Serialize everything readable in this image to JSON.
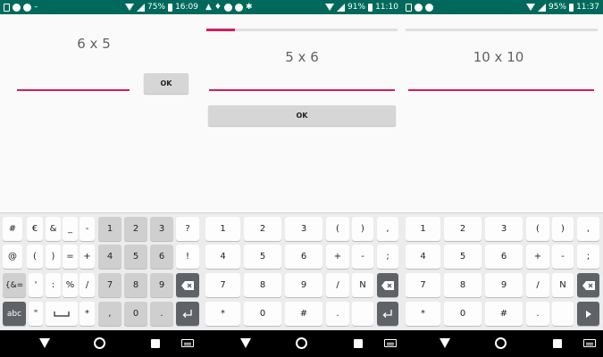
{
  "panels": [
    {
      "status": {
        "battery_pct": "75%",
        "time": "16:09"
      },
      "question": "6 x 5",
      "ok_label": "OK",
      "keys": [
        [
          "#",
          "€",
          "&",
          "_",
          "-",
          "1",
          "2",
          "3",
          "?"
        ],
        [
          "@",
          "(",
          ")",
          "=",
          "+",
          "4",
          "5",
          "6",
          "!"
        ],
        [
          "{&=",
          "'",
          ":",
          "%",
          "/",
          "7",
          "8",
          "9",
          ""
        ],
        [
          "abc",
          "\"",
          "",
          "*",
          ",",
          "0",
          ".",
          ""
        ]
      ]
    },
    {
      "status": {
        "battery_pct": "91%",
        "time": "11:10"
      },
      "question": "5 x 6",
      "ok_label": "OK",
      "progress_fraction": 0.15,
      "keys": [
        [
          "1",
          "2",
          "3",
          "(",
          ")",
          ","
        ],
        [
          "4",
          "5",
          "6",
          "+",
          "-",
          ";"
        ],
        [
          "7",
          "8",
          "9",
          "/",
          "N",
          ""
        ],
        [
          "*",
          "0",
          "#",
          ".",
          "",
          ""
        ]
      ]
    },
    {
      "status": {
        "battery_pct": "95%",
        "time": "11:37"
      },
      "question": "10 x 10",
      "progress_fraction": 0,
      "keys": [
        [
          "1",
          "2",
          "3",
          "(",
          ")",
          ","
        ],
        [
          "4",
          "5",
          "6",
          "+",
          "-",
          ";"
        ],
        [
          "7",
          "8",
          "9",
          "/",
          "N",
          ""
        ],
        [
          "*",
          "0",
          "#",
          ".",
          "",
          ""
        ]
      ]
    }
  ],
  "icons": {
    "backspace": "backspace-icon",
    "enter": "enter-icon",
    "space": "space-icon",
    "next": "next-icon"
  },
  "colors": {
    "status_bar": "#00695c",
    "accent": "#d81b60",
    "button": "#d6d6d6",
    "special_key": "#5f6368"
  }
}
